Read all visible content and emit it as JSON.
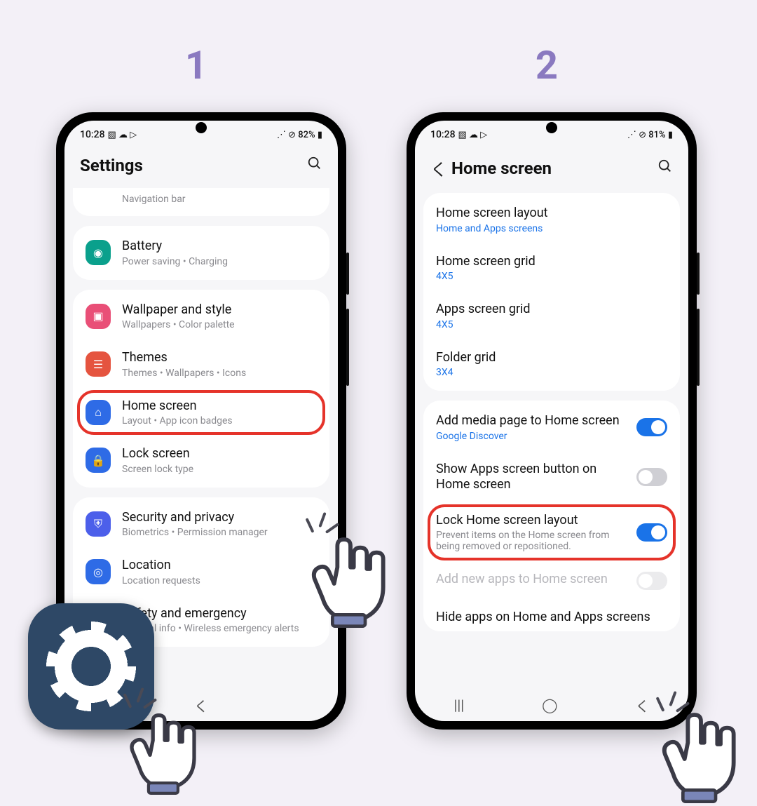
{
  "steps": {
    "one": "1",
    "two": "2"
  },
  "phone1": {
    "status": {
      "time": "10:28",
      "icons_left": "▧ ☁ ▷",
      "icons_right": "⋰ ⊘ 82% ▮",
      "battery": "82%"
    },
    "header": {
      "title": "Settings"
    },
    "partial_top": "Navigation bar",
    "rows": {
      "battery": {
        "title": "Battery",
        "sub": "Power saving  •  Charging"
      },
      "wallpaper": {
        "title": "Wallpaper and style",
        "sub": "Wallpapers  •  Color palette"
      },
      "themes": {
        "title": "Themes",
        "sub": "Themes  •  Wallpapers  •  Icons"
      },
      "home": {
        "title": "Home screen",
        "sub": "Layout  •  App icon badges"
      },
      "lock": {
        "title": "Lock screen",
        "sub": "Screen lock type"
      },
      "security": {
        "title": "Security and privacy",
        "sub": "Biometrics  •  Permission manager"
      },
      "location": {
        "title": "Location",
        "sub": "Location requests"
      },
      "safety": {
        "title": "Safety and emergency",
        "sub": "Medical info  •  Wireless emergency alerts"
      }
    }
  },
  "phone2": {
    "status": {
      "time": "10:28",
      "icons_left": "▧ ☁ ▷",
      "icons_right": "⋰ ⊘ 81% ▮",
      "battery": "81%"
    },
    "header": {
      "title": "Home screen"
    },
    "rows": {
      "layout": {
        "title": "Home screen layout",
        "sub": "Home and Apps screens"
      },
      "hgrid": {
        "title": "Home screen grid",
        "sub": "4X5"
      },
      "agrid": {
        "title": "Apps screen grid",
        "sub": "4X5"
      },
      "fgrid": {
        "title": "Folder grid",
        "sub": "3X4"
      },
      "media": {
        "title": "Add media page to Home screen",
        "sub": "Google Discover"
      },
      "appsbtn": {
        "title": "Show Apps screen button on Home screen"
      },
      "lock": {
        "title": "Lock Home screen layout",
        "sub": "Prevent items on the Home screen from being removed or repositioned."
      },
      "addnew": {
        "title": "Add new apps to Home screen"
      },
      "hide": {
        "title": "Hide apps on Home and Apps screens"
      }
    },
    "nav": {
      "recent": "|||",
      "home": "◯",
      "back": "く"
    }
  }
}
